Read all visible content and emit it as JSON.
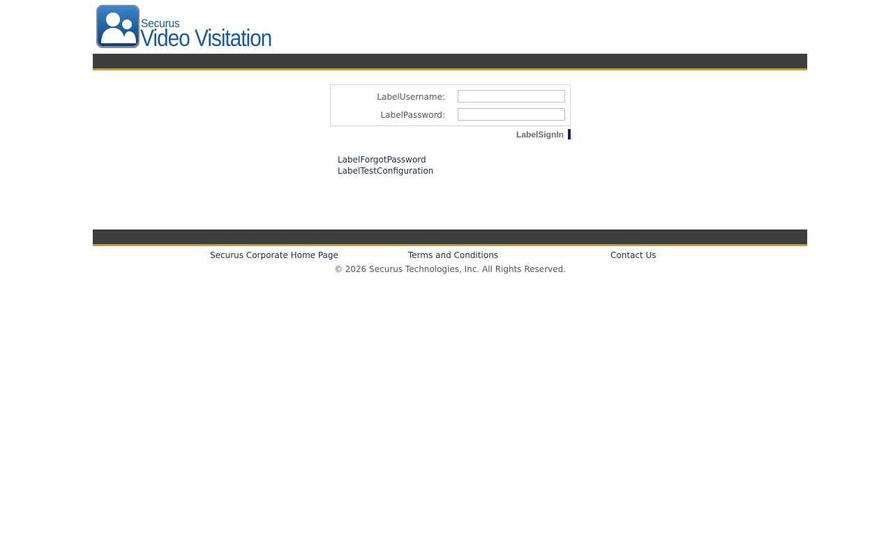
{
  "header": {
    "logo_small": "Securus",
    "logo_big": "Video Visitation",
    "colors": {
      "brand_blue": "#1a5b9a",
      "bar_dark": "#3d3c3f",
      "bar_gold": "#c59a3a"
    }
  },
  "login": {
    "username_label": "LabelUsername:",
    "username_value": "",
    "password_label": "LabelPassword:",
    "password_value": "",
    "signin_label": "LabelSignIn"
  },
  "links": {
    "forgot_password": "LabelForgotPassword",
    "test_configuration": "LabelTestConfiguration"
  },
  "footer": {
    "corporate_home": "Securus Corporate Home Page",
    "terms": "Terms and Conditions",
    "contact": "Contact Us",
    "copyright": "© 2026 Securus Technologies, Inc. All Rights Reserved."
  }
}
